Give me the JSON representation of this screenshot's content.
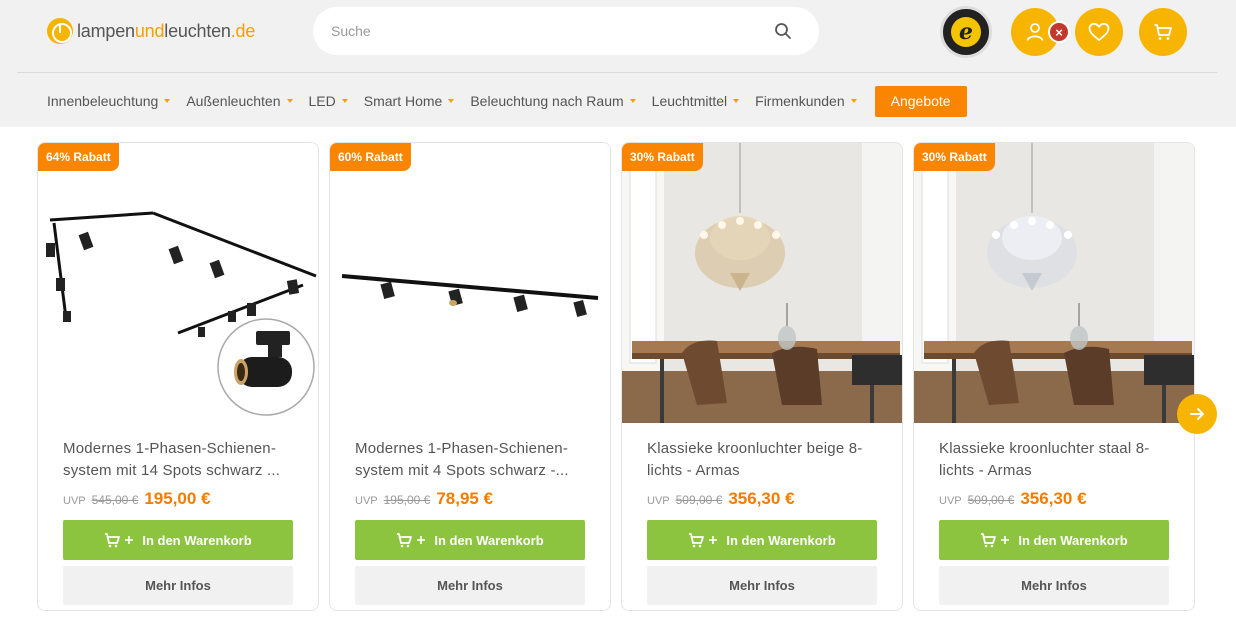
{
  "header": {
    "logo": {
      "part1": "lampen",
      "part2": "und",
      "part3": "leuchten",
      "tld": ".de"
    },
    "search": {
      "placeholder": "Suche"
    },
    "trusted_badge": {
      "icon": "trusted-shops-seal",
      "letter": "e"
    },
    "account": {
      "icon": "user-icon",
      "status_icon": "close-icon"
    },
    "wishlist": {
      "icon": "heart-icon"
    },
    "cart": {
      "icon": "cart-icon"
    }
  },
  "nav": {
    "items": [
      {
        "label": "Innenbeleuchtung"
      },
      {
        "label": "Außenleuchten"
      },
      {
        "label": "LED"
      },
      {
        "label": "Smart Home"
      },
      {
        "label": "Beleuchtung nach Raum"
      },
      {
        "label": "Leuchtmittel"
      },
      {
        "label": "Firmenkunden"
      }
    ],
    "offer_label": "Angebote"
  },
  "products": [
    {
      "badge": "64% Rabatt",
      "title": "Modernes 1-Phasen-Schienen-system mit 14 Spots schwarz ...",
      "uvp_label": "UVP",
      "old_price": "545,00 €",
      "price": "195,00 €",
      "cart_label": "In den Warenkorb",
      "info_label": "Mehr Infos"
    },
    {
      "badge": "60% Rabatt",
      "title": "Modernes 1-Phasen-Schienen-system mit 4 Spots schwarz -...",
      "uvp_label": "UVP",
      "old_price": "195,00 €",
      "price": "78,95 €",
      "cart_label": "In den Warenkorb",
      "info_label": "Mehr Infos"
    },
    {
      "badge": "30% Rabatt",
      "title": "Klassieke kroonluchter beige 8-lichts - Armas",
      "uvp_label": "UVP",
      "old_price": "509,00 €",
      "price": "356,30 €",
      "cart_label": "In den Warenkorb",
      "info_label": "Mehr Infos"
    },
    {
      "badge": "30% Rabatt",
      "title": "Klassieke kroonluchter staal 8-lichts - Armas",
      "uvp_label": "UVP",
      "old_price": "509,00 €",
      "price": "356,30 €",
      "cart_label": "In den Warenkorb",
      "info_label": "Mehr Infos"
    }
  ],
  "carousel": {
    "next_icon": "arrow-right-icon"
  },
  "colors": {
    "brand_yellow": "#f7b400",
    "offer_orange": "#f98500",
    "price_orange": "#f57c00",
    "cart_green": "#8cc43f"
  }
}
